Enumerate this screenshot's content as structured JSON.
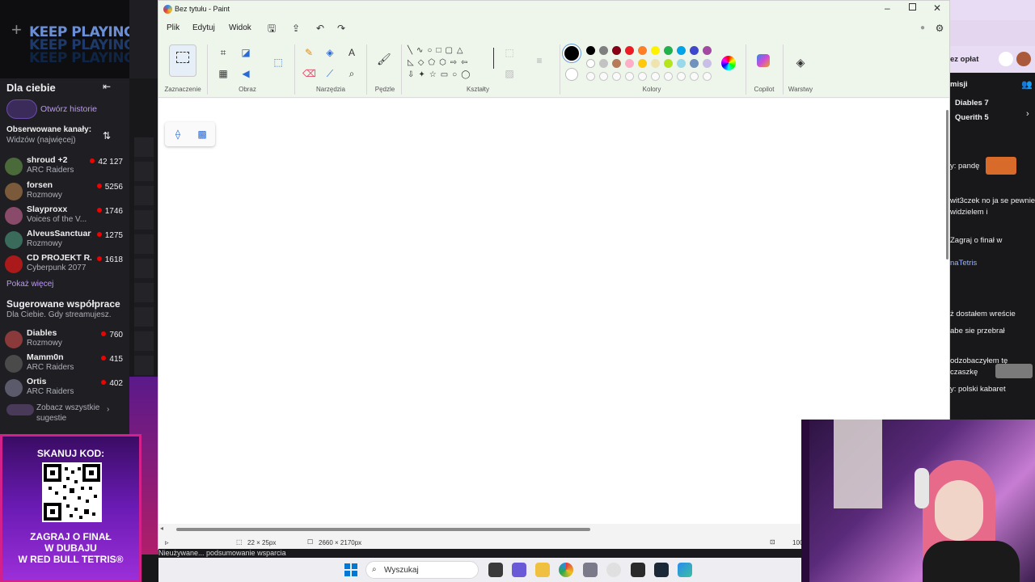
{
  "promo": {
    "line1": "KEEP PLAYING",
    "line2": "KEEP PLAYING",
    "line3": "KEEP PLAYING"
  },
  "twitch_sidebar": {
    "title": "Dla ciebie",
    "history_link": "Otwórz historie",
    "followed_label": "Obserwowane kanały:",
    "followed_sort": "Widzów (najwięcej)",
    "channels": [
      {
        "name": "shroud +2",
        "game": "ARC Raiders",
        "viewers": "42 127",
        "color": "#4a6a3a"
      },
      {
        "name": "forsen",
        "game": "Rozmowy",
        "viewers": "5256",
        "color": "#7a5a3a"
      },
      {
        "name": "Slayproxx",
        "game": "Voices of the V...",
        "viewers": "1746",
        "color": "#8a4a6a"
      },
      {
        "name": "AlveusSanctuary",
        "game": "Rozmowy",
        "viewers": "1275",
        "color": "#3a6a5a"
      },
      {
        "name": "CD PROJEKT R...",
        "game": "Cyberpunk 2077",
        "viewers": "1618",
        "color": "#aa1a1a"
      }
    ],
    "show_more": "Pokaż więcej",
    "suggested_title": "Sugerowane współprace",
    "suggested_sub": "Dla Ciebie. Gdy streamujesz.",
    "suggested": [
      {
        "name": "Diables",
        "game": "Rozmowy",
        "viewers": "760",
        "color": "#8a3a3a"
      },
      {
        "name": "Mamm0n",
        "game": "ARC Raiders",
        "viewers": "415",
        "color": "#4a4a4a"
      },
      {
        "name": "Ortis",
        "game": "ARC Raiders",
        "viewers": "402",
        "color": "#5a5a6a"
      }
    ],
    "see_all": "Zobacz wszystkie sugestie"
  },
  "qr_panel": {
    "title": "SKANUJ KOD:",
    "line1": "ZAGRAJ O FINAŁ",
    "line2": "W DUBAJU",
    "line3": "W RED BULL TETRIS®"
  },
  "paint": {
    "title": "Bez tytułu - Paint",
    "menu": [
      "Plik",
      "Edytuj",
      "Widok"
    ],
    "groups": {
      "selection": "Zaznaczenie",
      "image": "Obraz",
      "tools": "Narzędzia",
      "brushes": "Pędzle",
      "shapes": "Kształty",
      "colors": "Kolory",
      "copilot": "Copilot",
      "layers": "Warstwy"
    },
    "palette_row1": [
      "#000000",
      "#7f7f7f",
      "#880015",
      "#ed1c24",
      "#ff7f27",
      "#fff200",
      "#22b14c",
      "#00a2e8",
      "#3f48cc",
      "#a349a4"
    ],
    "palette_row2": [
      "#ffffff",
      "#c3c3c3",
      "#b97a57",
      "#ffaec9",
      "#ffc90e",
      "#efe4b0",
      "#b5e61d",
      "#99d9ea",
      "#7092be",
      "#c8bfe7"
    ],
    "status": {
      "cursor": "22 × 25px",
      "canvas_size": "2660 × 2170px",
      "zoom": "100"
    }
  },
  "chat": {
    "top_label": "ez opłat",
    "header": "misji",
    "lines": [
      {
        "text": "Diables  7",
        "color": "#efeff1"
      },
      {
        "text": "Querith  5",
        "color": "#efeff1"
      },
      {
        "text": "y: pandę",
        "color": "#efeff1"
      },
      {
        "text": "wit3czek no ja se pewnie",
        "color": "#adadb8"
      },
      {
        "text": "widzielem i",
        "color": "#efeff1"
      },
      {
        "text": "Zagraj o finał w",
        "color": "#efeff1"
      },
      {
        "text": "naTetris",
        "color": "#9ab5ff"
      },
      {
        "text": "ż dostałem wreście",
        "color": "#efeff1"
      },
      {
        "text": "abe sie przebrał",
        "color": "#efeff1"
      },
      {
        "text": "odzobaczyłem tę",
        "color": "#efeff1"
      },
      {
        "text": "czaszkę",
        "color": "#efeff1"
      },
      {
        "text": "y: polski kabaret",
        "color": "#efeff1"
      }
    ]
  },
  "taskbar": {
    "search_placeholder": "Wyszukaj"
  },
  "overlay_bottom": "Nieużywane... podsumowanie wsparcia"
}
